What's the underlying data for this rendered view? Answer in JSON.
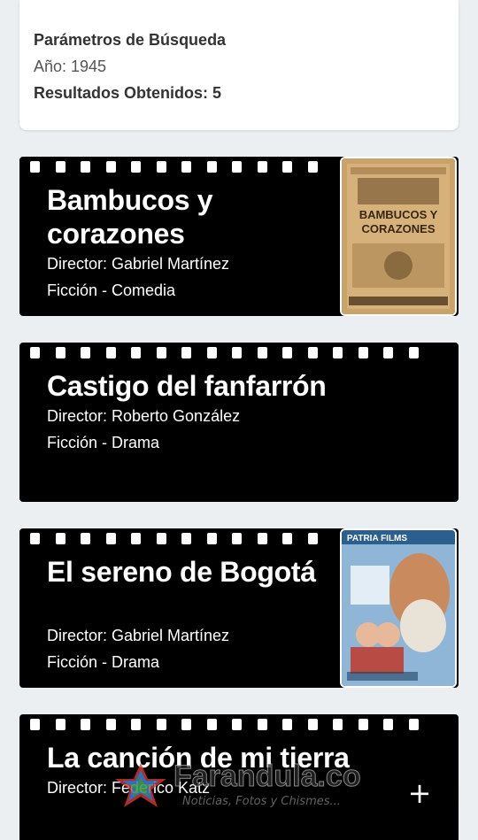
{
  "search_params": {
    "title": "Parámetros de Búsqueda",
    "year": "Año: 1945",
    "results": "Resultados Obtenidos: 5"
  },
  "films": [
    {
      "title": "Bambucos y corazones",
      "director": "Director: Gabriel Martínez",
      "genre": "Ficción - Comedia",
      "poster": "bambucos-poster",
      "poster_text_1": "BAMBUCOS Y",
      "poster_text_2": "CORAZONES"
    },
    {
      "title": "Castigo del fanfarrón",
      "director": "Director: Roberto González",
      "genre": "Ficción - Drama",
      "poster": null
    },
    {
      "title": "El sereno de Bogotá",
      "director": "Director: Gabriel Martínez",
      "genre": "Ficción - Drama",
      "poster": "sereno-poster",
      "poster_text_1": "PATRIA FILMS"
    },
    {
      "title": "La canción de mi tierra",
      "director": "Director: Federico Katz",
      "genre": "",
      "poster": null
    }
  ],
  "fab": {
    "label": "+",
    "icon": "plus-icon"
  },
  "watermark": {
    "brand": "Farandula.co",
    "tagline": "Noticias, Fotos y Chismes..."
  },
  "colors": {
    "background": "#eceff1",
    "card": "#000000",
    "text": "#ffffff",
    "params_text": "#333333"
  }
}
